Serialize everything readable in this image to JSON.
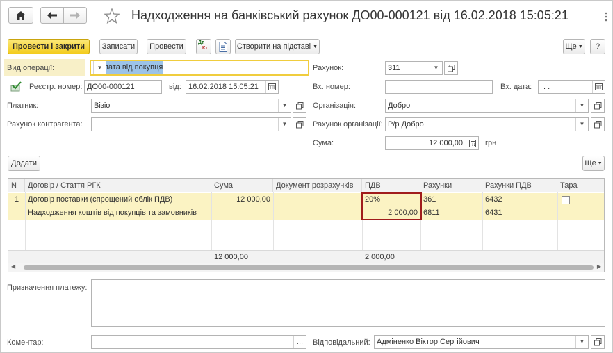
{
  "window": {
    "title": "Надходження на банківський рахунок ДО00-000121 від 16.02.2018 15:05:21"
  },
  "toolbar": {
    "post_close": "Провести і закрити",
    "save": "Записати",
    "post": "Провести",
    "create_based": "Створити на підставі",
    "more": "Ще",
    "help": "?",
    "dt_kt_top": "Дт",
    "dt_kt_bottom": "Кт"
  },
  "form": {
    "operation_label": "Вид операції:",
    "operation_value": "Оплата від покупця",
    "account_label": "Рахунок:",
    "account_value": "311",
    "reg_label": "Реєстр. номер:",
    "reg_value": "ДО00-000121",
    "from_label": "від:",
    "from_value": "16.02.2018 15:05:21",
    "in_num_label": "Вх. номер:",
    "in_num_value": "",
    "in_date_label": "Вх. дата:",
    "in_date_value": ". .",
    "payer_label": "Платник:",
    "payer_value": "Візіо",
    "org_label": "Організація:",
    "org_value": "Добро",
    "counter_account_label": "Рахунок контрагента:",
    "counter_account_value": "",
    "org_account_label": "Рахунок організації:",
    "org_account_value": "Р/р Добро",
    "sum_label": "Сума:",
    "sum_value": "12 000,00",
    "currency": "грн"
  },
  "table_toolbar": {
    "add": "Додати",
    "more": "Ще"
  },
  "table": {
    "headers": [
      "N",
      "Договір / Стаття РГК",
      "Сума",
      "Документ розрахунків",
      "ПДВ",
      "Рахунки",
      "Рахунки ПДВ",
      "Тара"
    ],
    "row": {
      "n": "1",
      "contract": "Договір поставки (спрощений облік ПДВ)",
      "article": "Надходження коштів від покупців та замовників",
      "sum": "12 000,00",
      "doc": "",
      "vat_rate": "20%",
      "vat_sum": "2 000,00",
      "accounts_1": "361",
      "accounts_2": "6811",
      "vat_accounts_1": "6432",
      "vat_accounts_2": "6431"
    },
    "totals": {
      "sum": "12 000,00",
      "vat": "2 000,00"
    }
  },
  "bottom": {
    "purpose_label": "Призначення платежу:",
    "purpose_value": "",
    "comment_label": "Коментар:",
    "comment_value": "",
    "comment_btn": "...",
    "responsible_label": "Відповідальний:",
    "responsible_value": "Адміненко Віктор Сергійович"
  }
}
